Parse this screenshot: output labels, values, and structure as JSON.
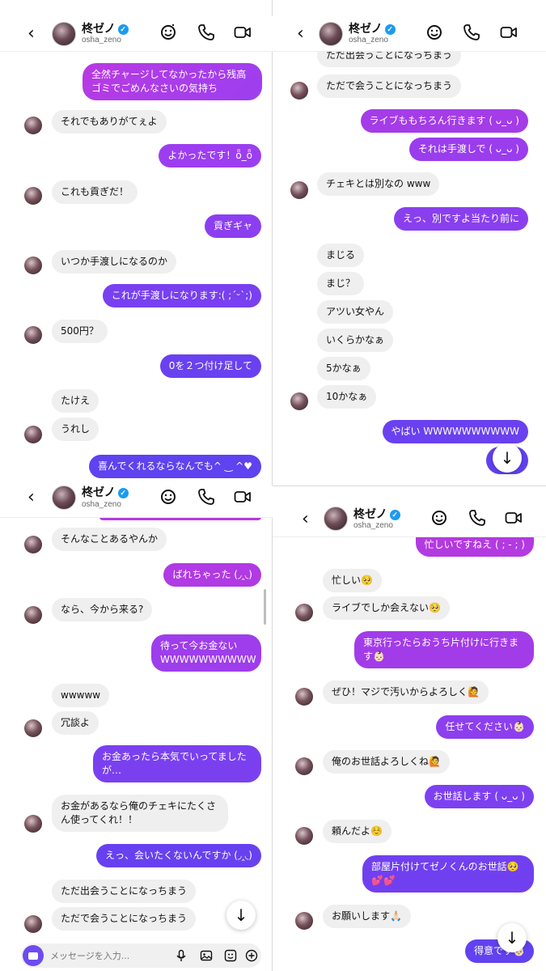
{
  "contact": {
    "name": "柊ゼノ",
    "handle": "osha_zeno",
    "verified_mark": "✓"
  },
  "icons": {
    "back": "chevron-left-icon",
    "effects": "sticker-smile-icon",
    "call": "phone-icon",
    "video": "video-camera-icon",
    "scroll_down": "arrow-down-icon",
    "composer": [
      "camera-icon",
      "microphone-icon",
      "image-icon",
      "sticker-icon",
      "plus-icon"
    ]
  },
  "colors": {
    "bubble_outgoing_top": "#b43ae0",
    "bubble_outgoing_bottom": "#5b3ff0",
    "bubble_incoming": "#efefef",
    "verified": "#1d9bf0"
  },
  "composer": {
    "placeholder": "メッセージを入力..."
  },
  "scroll_down_glyph": "↓",
  "back_glyph": "‹",
  "panels": {
    "top_left": {
      "messages": [
        {
          "dir": "out",
          "text": "全然チャージしてなかったから残高ゴミでごめんなさいの気持ち"
        },
        {
          "dir": "in",
          "text": "それでもありがてぇよ"
        },
        {
          "dir": "out",
          "text": "よかったです！ȫ_ȫ"
        },
        {
          "dir": "in",
          "text": "これも貢ぎだ！"
        },
        {
          "dir": "out",
          "text": "貢ぎギャ"
        },
        {
          "dir": "in",
          "text": "いつか手渡しになるのか"
        },
        {
          "dir": "out",
          "text": "これが手渡しになります:( ;´ᵕ`;)"
        },
        {
          "dir": "in",
          "text": "500円？"
        },
        {
          "dir": "out",
          "text": "0を２つ付け足して"
        },
        {
          "dir": "in",
          "text": "たけえ"
        },
        {
          "dir": "in",
          "text": "うれし"
        },
        {
          "dir": "out",
          "text": "喜んでくれるならなんでも^ ‿ ^♥"
        }
      ]
    },
    "top_right": {
      "messages": [
        {
          "dir": "in",
          "text": "ただ出会うことになっちまう"
        },
        {
          "dir": "in",
          "text": "ただで会うことになっちまう"
        },
        {
          "dir": "out",
          "text": "ライブももちろん行きます ( ᴗ_ᴗ )"
        },
        {
          "dir": "out",
          "text": "それは手渡しで ( ᴗ_ᴗ )"
        },
        {
          "dir": "in",
          "text": "チェキとは別なの www"
        },
        {
          "dir": "out",
          "text": "えっ、別ですよ当たり前に"
        },
        {
          "dir": "in",
          "text": "まじる"
        },
        {
          "dir": "in",
          "text": "まじ？"
        },
        {
          "dir": "in",
          "text": "アツい女やん"
        },
        {
          "dir": "in",
          "text": "いくらかなぁ"
        },
        {
          "dir": "in",
          "text": "5かなぁ"
        },
        {
          "dir": "in",
          "text": "10かなぁ"
        },
        {
          "dir": "out",
          "text": "やばい WWWWWWWWWW"
        }
      ]
    },
    "bottom_left": {
      "messages": [
        {
          "dir": "in",
          "text": "そんなことあるやんか"
        },
        {
          "dir": "out",
          "text": "ばれちゃった (◞‸◟)"
        },
        {
          "dir": "in",
          "text": "なら、今から来る?"
        },
        {
          "dir": "out",
          "text": "待って今お金ない WWWWWWWWWW"
        },
        {
          "dir": "in",
          "text": "wwwww"
        },
        {
          "dir": "in",
          "text": "冗談よ"
        },
        {
          "dir": "out",
          "text": "お金あったら本気でいってましたが…"
        },
        {
          "dir": "in",
          "text": "お金があるなら俺のチェキにたくさん使ってくれ！！"
        },
        {
          "dir": "out",
          "text": "えっ、会いたくないんですか (◞‸◟)"
        },
        {
          "dir": "in",
          "text": "ただ出会うことになっちまう"
        },
        {
          "dir": "in",
          "text": "ただで会うことになっちまう"
        }
      ]
    },
    "bottom_right": {
      "messages": [
        {
          "dir": "out",
          "text": "忙しいですねえ ( ; - ; )"
        },
        {
          "dir": "in",
          "text": "忙しい🥺"
        },
        {
          "dir": "in",
          "text": "ライブでしか会えない🥺"
        },
        {
          "dir": "out",
          "text": "東京行ったらおうち片付けに行きます👶🏻"
        },
        {
          "dir": "in",
          "text": "ぜひ！マジで汚いからよろしく🙋"
        },
        {
          "dir": "out",
          "text": "任せてください👶🏻"
        },
        {
          "dir": "in",
          "text": "俺のお世話よろしくね🙋"
        },
        {
          "dir": "out",
          "text": "お世話します ( ᴗ_ᴗ )"
        },
        {
          "dir": "in",
          "text": "頼んだよ☺️"
        },
        {
          "dir": "out",
          "text": "部屋片付けてゼノくんのお世話🥺💕💕"
        },
        {
          "dir": "in",
          "text": "お願いします🙏🏻"
        },
        {
          "dir": "out",
          "text": "得意です👶🏻"
        }
      ]
    }
  }
}
